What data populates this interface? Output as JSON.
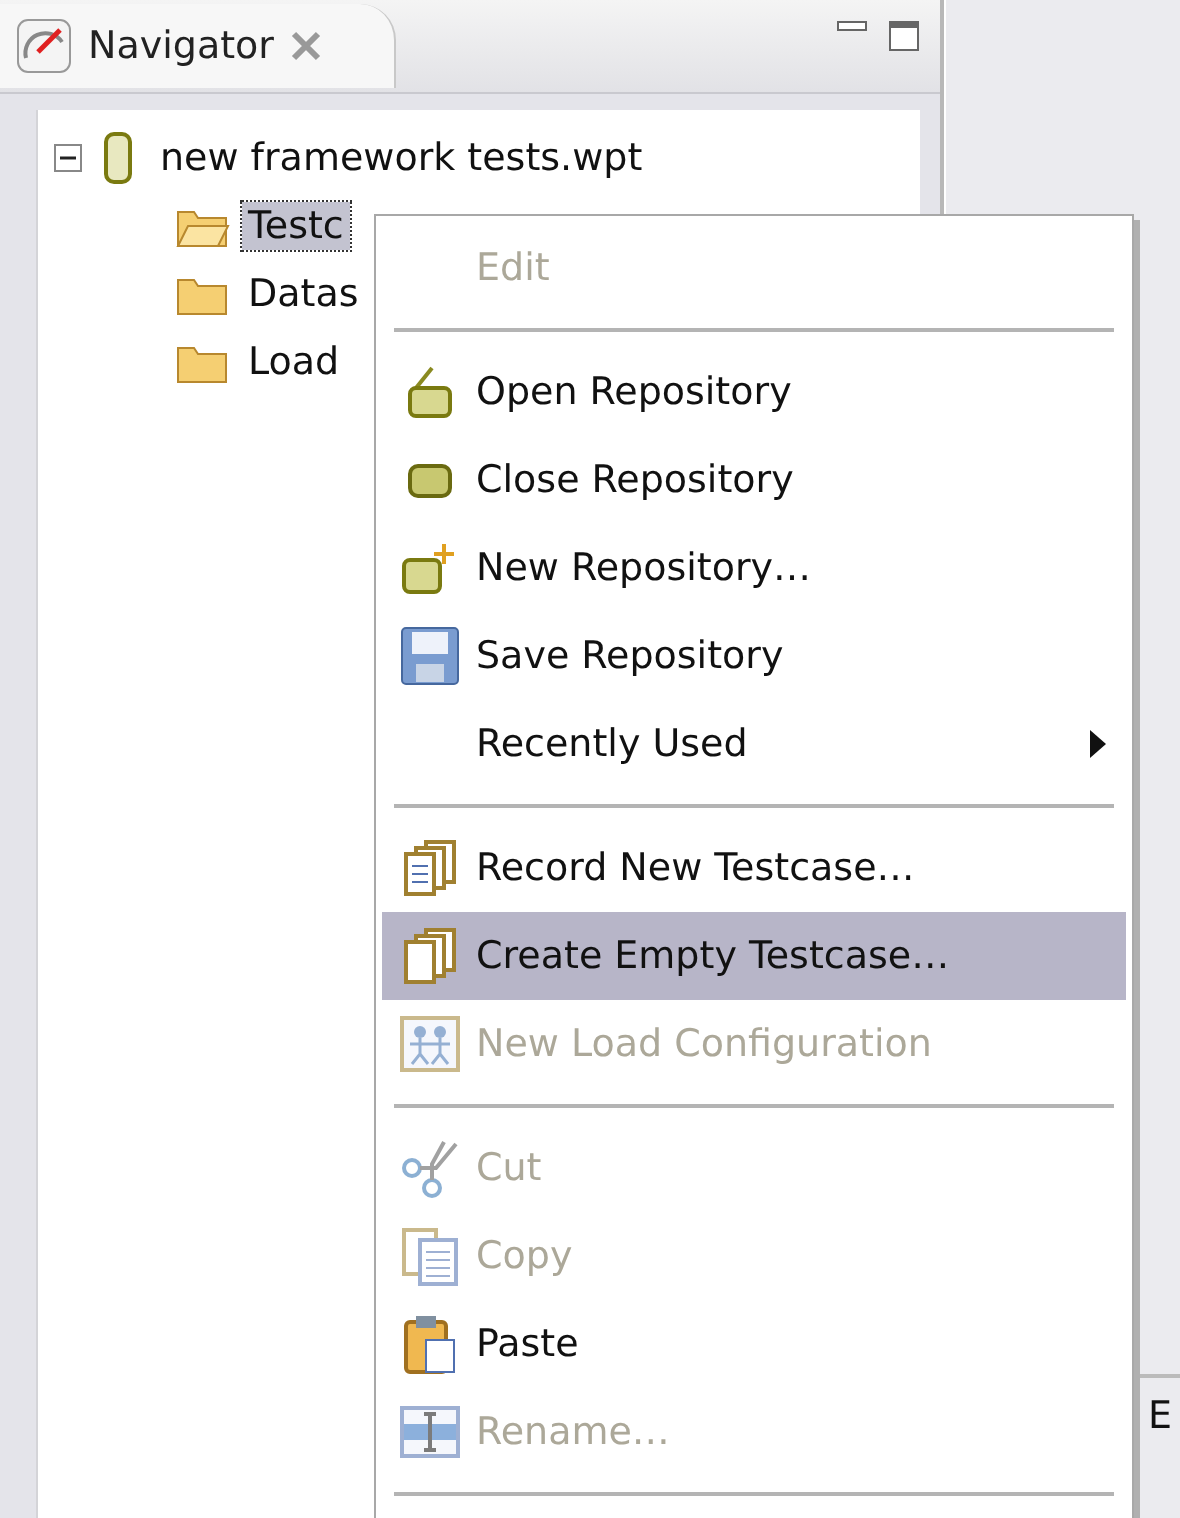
{
  "view": {
    "title": "Navigator"
  },
  "tree": {
    "root": {
      "label": "new framework tests.wpt",
      "expanded": true,
      "children": [
        {
          "label": "Testc",
          "selected": true,
          "open": true
        },
        {
          "label": "Datas",
          "selected": false,
          "open": false
        },
        {
          "label": "Load",
          "selected": false,
          "open": false
        }
      ]
    }
  },
  "context_menu": {
    "items": [
      {
        "kind": "item",
        "label": "Edit",
        "disabled": true,
        "selected": false
      },
      {
        "kind": "separator"
      },
      {
        "kind": "item",
        "label": "Open Repository",
        "disabled": false,
        "selected": false
      },
      {
        "kind": "item",
        "label": "Close Repository",
        "disabled": false,
        "selected": false
      },
      {
        "kind": "item",
        "label": "New Repository…",
        "disabled": false,
        "selected": false
      },
      {
        "kind": "item",
        "label": "Save Repository",
        "disabled": false,
        "selected": false
      },
      {
        "kind": "item",
        "label": "Recently Used",
        "disabled": false,
        "selected": false,
        "submenu": true
      },
      {
        "kind": "separator"
      },
      {
        "kind": "item",
        "label": "Record New Testcase…",
        "disabled": false,
        "selected": false
      },
      {
        "kind": "item",
        "label": "Create Empty Testcase…",
        "disabled": false,
        "selected": true
      },
      {
        "kind": "item",
        "label": "New Load Configuration",
        "disabled": true,
        "selected": false
      },
      {
        "kind": "separator"
      },
      {
        "kind": "item",
        "label": "Cut",
        "disabled": true,
        "selected": false
      },
      {
        "kind": "item",
        "label": "Copy",
        "disabled": true,
        "selected": false
      },
      {
        "kind": "item",
        "label": "Paste",
        "disabled": false,
        "selected": false
      },
      {
        "kind": "item",
        "label": "Rename…",
        "disabled": true,
        "selected": false
      },
      {
        "kind": "separator"
      }
    ]
  },
  "side_panel": {
    "status_text": "E"
  }
}
